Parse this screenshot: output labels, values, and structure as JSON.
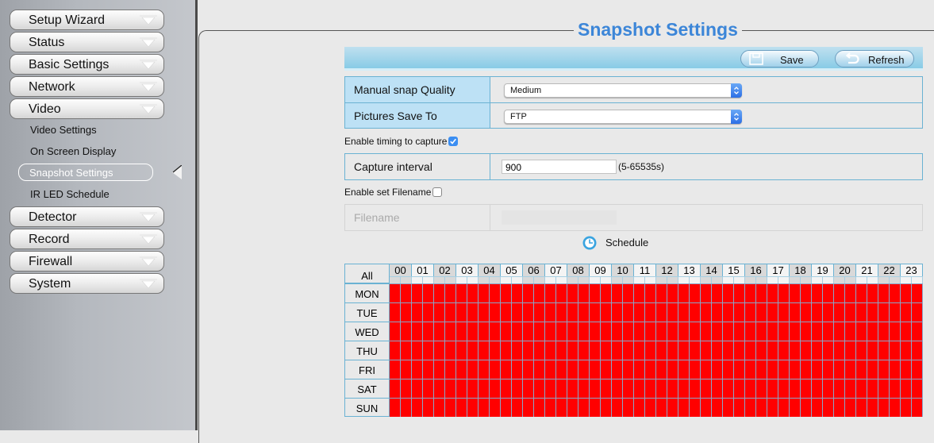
{
  "sidebar": {
    "menus_top": [
      {
        "label": "Setup Wizard",
        "id": "setup-wizard"
      },
      {
        "label": "Status",
        "id": "status"
      },
      {
        "label": "Basic Settings",
        "id": "basic-settings"
      },
      {
        "label": "Network",
        "id": "network"
      },
      {
        "label": "Video",
        "id": "video"
      }
    ],
    "video_submenu": [
      {
        "label": "Video Settings",
        "active": false
      },
      {
        "label": "On Screen Display",
        "active": false
      },
      {
        "label": "Snapshot Settings",
        "active": true
      },
      {
        "label": "IR LED Schedule",
        "active": false
      }
    ],
    "menus_bottom": [
      {
        "label": "Detector",
        "id": "detector"
      },
      {
        "label": "Record",
        "id": "record"
      },
      {
        "label": "Firewall",
        "id": "firewall"
      },
      {
        "label": "System",
        "id": "system"
      }
    ]
  },
  "page": {
    "title": "Snapshot Settings",
    "toolbar": {
      "save_label": "Save",
      "refresh_label": "Refresh"
    }
  },
  "form": {
    "manual_snap_quality": {
      "label": "Manual snap Quality",
      "value": "Medium"
    },
    "pictures_save_to": {
      "label": "Pictures Save To",
      "value": "FTP"
    },
    "enable_timing": {
      "label": "Enable timing to capture",
      "checked": true
    },
    "capture_interval": {
      "label": "Capture interval",
      "value": "900",
      "hint": "(5-65535s)"
    },
    "enable_filename": {
      "label": "Enable set Filename",
      "checked": false
    },
    "filename": {
      "label": "Filename",
      "value": ""
    },
    "schedule_label": "Schedule"
  },
  "schedule": {
    "all_label": "All",
    "hours": [
      "00",
      "01",
      "02",
      "03",
      "04",
      "05",
      "06",
      "07",
      "08",
      "09",
      "10",
      "11",
      "12",
      "13",
      "14",
      "15",
      "16",
      "17",
      "18",
      "19",
      "20",
      "21",
      "22",
      "23"
    ],
    "days": [
      "MON",
      "TUE",
      "WED",
      "THU",
      "FRI",
      "SAT",
      "SUN"
    ],
    "slots_per_hour": 2,
    "all_selected": true,
    "selected_color": "#ff0000"
  },
  "colors": {
    "accent_title": "#3c86d8",
    "table_border": "#6ab2d3",
    "label_bg": "#bde1f5"
  }
}
